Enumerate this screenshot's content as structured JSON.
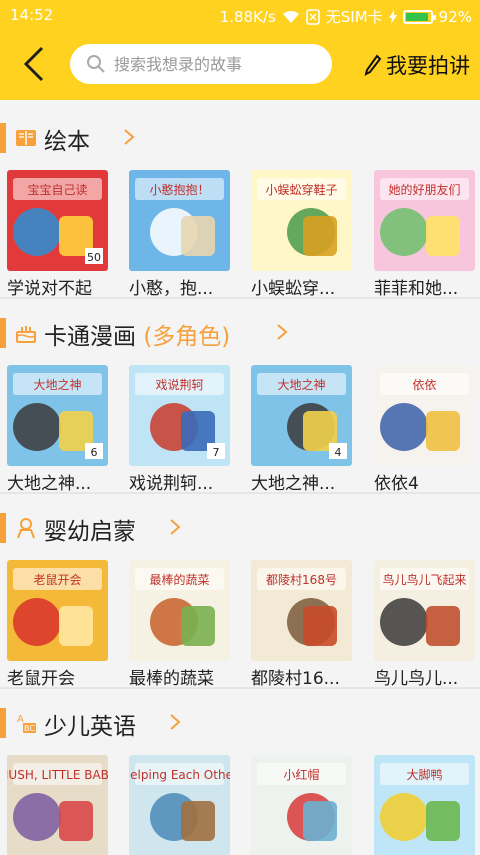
{
  "status": {
    "time": "14:52",
    "speed": "1.88K/s",
    "sim": "无SIM卡",
    "battery": "92%",
    "battery_level": 0.92
  },
  "header": {
    "search_placeholder": "搜索我想录的故事",
    "record_label": "我要拍讲"
  },
  "sections": [
    {
      "title": "绘本",
      "subtitle": "",
      "icon": "book-icon",
      "books": [
        {
          "title": "学说对不起",
          "cover_text": "宝宝自己读",
          "badge": "50",
          "colors": [
            "#e23a3a",
            "#2a8fd6",
            "#ffd23f"
          ]
        },
        {
          "title": "小憨，抱...",
          "cover_text": "小憨抱抱！",
          "colors": [
            "#6fb6e8",
            "#ffffff",
            "#e8d6b0"
          ]
        },
        {
          "title": "小蜈蚣穿...",
          "cover_text": "小蜈蚣穿鞋子",
          "colors": [
            "#fff7c8",
            "#4a9a4a",
            "#d8a020"
          ]
        },
        {
          "title": "菲菲和她...",
          "cover_text": "她的好朋友们",
          "colors": [
            "#f8c6dc",
            "#6dbf6a",
            "#ffe066"
          ]
        }
      ]
    },
    {
      "title": "卡通漫画",
      "subtitle": "(多角色)",
      "icon": "cake-icon",
      "books": [
        {
          "title": "大地之神...",
          "cover_text": "大地之神",
          "badge": "6",
          "colors": [
            "#7fc4e8",
            "#3a3a3a",
            "#f2d24a"
          ]
        },
        {
          "title": "戏说荆轲...",
          "cover_text": "戏说荆轲",
          "badge": "7",
          "colors": [
            "#bfe4f6",
            "#c83a2a",
            "#3a6ab8"
          ]
        },
        {
          "title": "大地之神...",
          "cover_text": "大地之神",
          "badge": "4",
          "colors": [
            "#7fc4e8",
            "#3a3a3a",
            "#f2d24a"
          ]
        },
        {
          "title": "依依4",
          "cover_text": "依依",
          "colors": [
            "#f6f3ee",
            "#3a5ea8",
            "#f0c040"
          ]
        }
      ]
    },
    {
      "title": "婴幼启蒙",
      "subtitle": "",
      "icon": "baby-icon",
      "books": [
        {
          "title": "老鼠开会",
          "cover_text": "老鼠开会",
          "colors": [
            "#f5b93a",
            "#d8302a",
            "#ffe7a0"
          ]
        },
        {
          "title": "最棒的蔬菜",
          "cover_text": "最棒的蔬菜",
          "colors": [
            "#f5f1e3",
            "#c7602a",
            "#7ab050"
          ]
        },
        {
          "title": "都陵村16...",
          "cover_text": "都陵村168号",
          "colors": [
            "#f3ead6",
            "#7a5a3a",
            "#c84a2a"
          ]
        },
        {
          "title": "鸟儿鸟儿...",
          "cover_text": "鸟儿鸟儿飞起来",
          "colors": [
            "#f5efe2",
            "#3a3a3a",
            "#c05030"
          ]
        }
      ]
    },
    {
      "title": "少儿英语",
      "subtitle": "",
      "icon": "abc-icon",
      "books": [
        {
          "title": "",
          "cover_text": "HUSH, LITTLE BABY",
          "colors": [
            "#e6dcc8",
            "#7a5aa0",
            "#d84848"
          ]
        },
        {
          "title": "",
          "cover_text": "Helping Each Other",
          "colors": [
            "#cfe6ee",
            "#4a8ab8",
            "#a07040"
          ]
        },
        {
          "title": "",
          "cover_text": "小红帽",
          "colors": [
            "#eef2ee",
            "#d83a3a",
            "#6ab0d0"
          ]
        },
        {
          "title": "",
          "cover_text": "大脚鸭",
          "colors": [
            "#bfe6f6",
            "#f2cc2a",
            "#6ab850"
          ]
        }
      ]
    }
  ]
}
